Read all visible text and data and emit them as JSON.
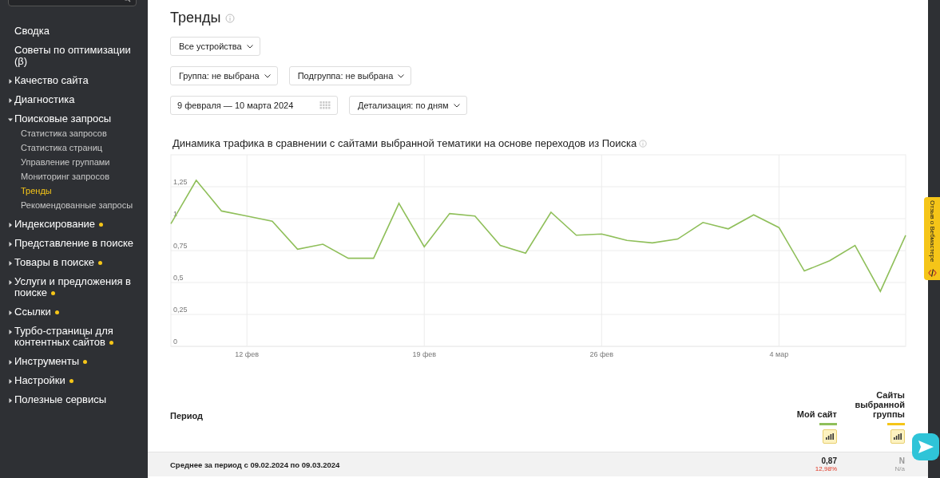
{
  "sidebar": {
    "items": [
      {
        "kind": "link",
        "label": "Сводка",
        "dot": false
      },
      {
        "kind": "link",
        "label": "Советы по оптимизации (β)",
        "dot": false
      },
      {
        "kind": "group",
        "label": "Качество сайта",
        "expanded": false,
        "dot": false
      },
      {
        "kind": "group",
        "label": "Диагностика",
        "expanded": false,
        "dot": false
      },
      {
        "kind": "group",
        "label": "Поисковые запросы",
        "expanded": true,
        "dot": false,
        "children": [
          {
            "label": "Статистика запросов",
            "selected": false
          },
          {
            "label": "Статистика страниц",
            "selected": false
          },
          {
            "label": "Управление группами",
            "selected": false
          },
          {
            "label": "Мониторинг запросов",
            "selected": false
          },
          {
            "label": "Тренды",
            "selected": true
          },
          {
            "label": "Рекомендованные запросы",
            "selected": false
          }
        ]
      },
      {
        "kind": "group",
        "label": "Индексирование",
        "expanded": false,
        "dot": true
      },
      {
        "kind": "group",
        "label": "Представление в поиске",
        "expanded": false,
        "dot": false
      },
      {
        "kind": "group",
        "label": "Товары в поиске",
        "expanded": false,
        "dot": true
      },
      {
        "kind": "group",
        "label": "Услуги и предложения в поиске",
        "expanded": false,
        "dot": true
      },
      {
        "kind": "group",
        "label": "Ссылки",
        "expanded": false,
        "dot": true
      },
      {
        "kind": "group",
        "label": "Турбо-страницы для контентных сайтов",
        "expanded": false,
        "dot": true
      },
      {
        "kind": "group",
        "label": "Инструменты",
        "expanded": false,
        "dot": true
      },
      {
        "kind": "group",
        "label": "Настройки",
        "expanded": false,
        "dot": true
      },
      {
        "kind": "group",
        "label": "Полезные сервисы",
        "expanded": false,
        "dot": false
      }
    ]
  },
  "page": {
    "title": "Тренды"
  },
  "filters": [
    [
      {
        "kind": "dropdown",
        "label": "Все устройства"
      }
    ],
    [
      {
        "kind": "dropdown",
        "label": "Группа: не выбрана"
      },
      {
        "kind": "dropdown",
        "label": "Подгруппа: не выбрана"
      }
    ],
    [
      {
        "kind": "date",
        "label": "9 февраля — 10 марта 2024"
      },
      {
        "kind": "dropdown",
        "label": "Детализация: по дням"
      }
    ]
  ],
  "chart": {
    "title": "Динамика трафика в сравнении с сайтами выбранной тематики на основе переходов из Поиска",
    "chart_data": {
      "type": "line",
      "grid": true,
      "categories": [
        null,
        null,
        null,
        "12 фев",
        null,
        null,
        null,
        null,
        null,
        null,
        "19 фев",
        null,
        null,
        null,
        null,
        null,
        null,
        "26 фев",
        null,
        null,
        null,
        null,
        null,
        null,
        "4 мар",
        null,
        null,
        null,
        null,
        null
      ],
      "series": [
        {
          "color": "#8fbf5a",
          "values": [
            0.96,
            1.3,
            1.06,
            1.02,
            0.98,
            0.76,
            0.8,
            0.69,
            0.69,
            1.12,
            0.78,
            1.04,
            1.02,
            0.79,
            0.73,
            1.05,
            0.87,
            0.88,
            0.83,
            0.81,
            0.84,
            0.97,
            0.92,
            1.03,
            0.93,
            0.59,
            0.67,
            0.79,
            0.43,
            0.87
          ]
        }
      ],
      "ylim": [
        0,
        1.5
      ],
      "yticks": [
        {
          "value": 0,
          "label": "0"
        },
        {
          "value": 0.25,
          "label": "0,25"
        },
        {
          "value": 0.5,
          "label": "0,5"
        },
        {
          "value": 0.75,
          "label": "0,75"
        },
        {
          "value": 1,
          "label": "1"
        },
        {
          "value": 1.25,
          "label": "1,25"
        }
      ]
    }
  },
  "table": {
    "columns": [
      {
        "label": "Период"
      },
      {
        "label": "Мой сайт",
        "color": "#8fbf5a"
      },
      {
        "label": "Сайты выбранной группы",
        "color": "#f5c518"
      }
    ],
    "rows": [
      {
        "cells": [
          {
            "value": "Среднее за период с 09.02.2024 по 09.03.2024"
          },
          {
            "value": "0,87",
            "change": "12,98%"
          },
          {
            "value": "N",
            "change": "N/a"
          }
        ]
      }
    ]
  },
  "feedback_tab": {
    "label": "Отзыв о Вебмастере"
  }
}
